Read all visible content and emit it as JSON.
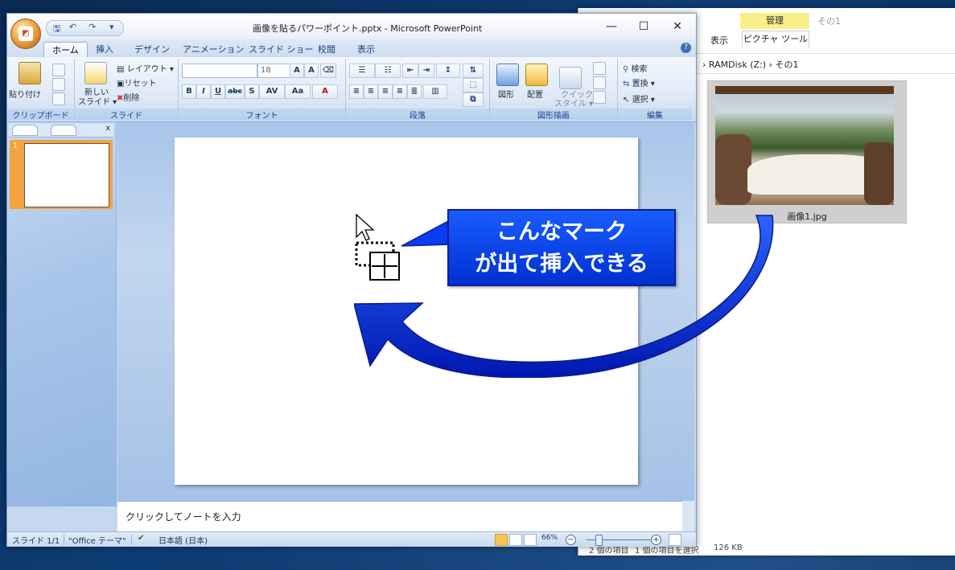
{
  "explorer": {
    "manage_tab": "管理",
    "context_tab": "その1",
    "view_tab": "表示",
    "picture_tools_tab": "ピクチャ ツール",
    "address": "›  RAMDisk (Z:)  ›  その1",
    "file_name": "画像1.jpg",
    "status_items": "2 個の項目",
    "status_selected": "1 個の項目を選択",
    "status_size": "126 KB"
  },
  "ppt": {
    "title": "画像を貼るパワーポイント.pptx - Microsoft PowerPoint",
    "qat": {
      "save": "🖫",
      "undo": "↶",
      "redo": "↷",
      "more": "▾"
    },
    "window_controls": {
      "minimize": "—",
      "maximize": "☐",
      "close": "✕"
    },
    "tabs": [
      "ホーム",
      "挿入",
      "デザイン",
      "アニメーション",
      "スライド ショー",
      "校閲",
      "表示"
    ],
    "ribbon": {
      "clipboard": {
        "paste": "貼り付け",
        "label": "クリップボード"
      },
      "slides": {
        "new_slide_line1": "新しい",
        "new_slide_line2": "スライド ▾",
        "layout": "レイアウト ▾",
        "reset": "リセット",
        "delete": "削除",
        "label": "スライド"
      },
      "font": {
        "size": "18",
        "label": "フォント",
        "bold": "B",
        "italic": "I",
        "underline": "U",
        "strike": "abc",
        "shadow": "S",
        "spacing": "AV",
        "case": "Aa",
        "color": "A"
      },
      "paragraph": {
        "label": "段落"
      },
      "drawing": {
        "shapes": "図形",
        "arrange": "配置",
        "quick_style_1": "クイック",
        "quick_style_2": "スタイル ▾",
        "label": "図形描画"
      },
      "editing": {
        "find": "検索",
        "replace": "置換 ▾",
        "select": "選択 ▾",
        "label": "編集"
      }
    },
    "slide_panel": {
      "slide_number": "1"
    },
    "notes_placeholder": "クリックしてノートを入力",
    "status": {
      "slide": "スライド 1/1",
      "theme": "\"Office テーマ\"",
      "language": "日本語 (日本)",
      "zoom": "66%",
      "zoom_minus": "−",
      "zoom_plus": "+"
    }
  },
  "callout": {
    "line1": "こんなマーク",
    "line2": "が出て挿入できる"
  },
  "colors": {
    "callout_fill": "#0a3cf0",
    "arrow_fill": "#0a2fd8",
    "manage_tab": "#f7f08a"
  }
}
